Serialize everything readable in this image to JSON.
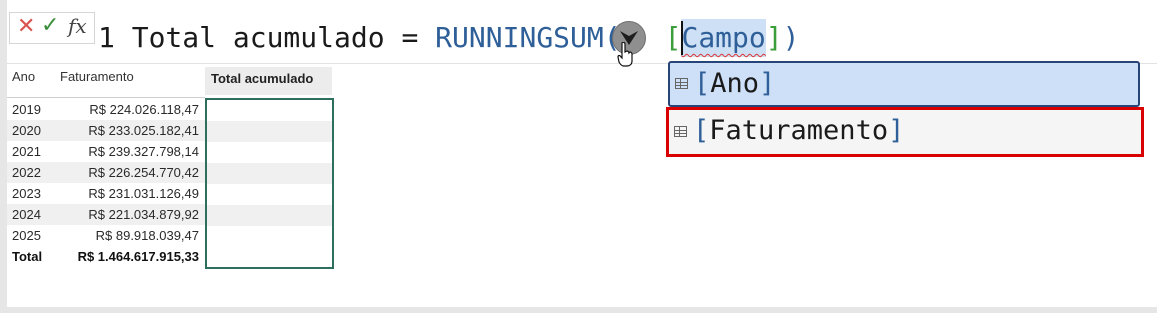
{
  "formula_bar": {
    "cancel_icon": "✕",
    "commit_icon": "✓",
    "fx_label": "fx",
    "line_number": "1",
    "measure_name": "Total acumulado",
    "equals": "=",
    "function_name": "RUNNINGSUM(",
    "open_bracket": "[",
    "placeholder_param": "Campo",
    "close_bracket": "]",
    "close_paren": ")"
  },
  "autocomplete": {
    "items": [
      {
        "open": "[",
        "label": "Ano",
        "close": "]",
        "selected": true
      },
      {
        "open": "[",
        "label": "Faturamento",
        "close": "]",
        "highlighted": true,
        "highlight_color": "#d80000"
      }
    ]
  },
  "table": {
    "headers": [
      "Ano",
      "Faturamento",
      "Total acumulado"
    ],
    "rows": [
      {
        "ano": "2019",
        "faturamento": "R$ 224.026.118,47"
      },
      {
        "ano": "2020",
        "faturamento": "R$ 233.025.182,41"
      },
      {
        "ano": "2021",
        "faturamento": "R$ 239.327.798,14"
      },
      {
        "ano": "2022",
        "faturamento": "R$ 226.254.770,42"
      },
      {
        "ano": "2023",
        "faturamento": "R$ 231.031.126,49"
      },
      {
        "ano": "2024",
        "faturamento": "R$ 221.034.879,92"
      },
      {
        "ano": "2025",
        "faturamento": "R$ 89.918.039,47"
      }
    ],
    "total": {
      "label": "Total",
      "faturamento": "R$ 1.464.617.915,33"
    }
  },
  "colors": {
    "function": "#2f5f98",
    "bracket": "#3a9e3a",
    "selection": "#cde0f5",
    "column_border": "#2e6e5c"
  },
  "icons": [
    "cancel-icon",
    "commit-icon",
    "fx-icon",
    "parameter-dropdown-icon",
    "hand-cursor-icon",
    "table-column-icon"
  ]
}
